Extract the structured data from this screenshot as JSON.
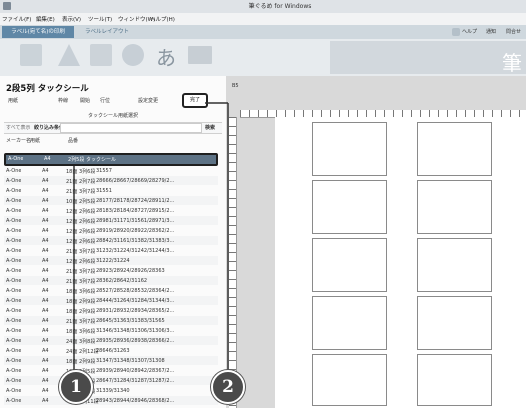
{
  "window": {
    "title": "筆ぐるめ for Windows"
  },
  "menu": [
    "ファイル(F)",
    "編集(E)",
    "表示(V)",
    "ツール(T)",
    "ウィンドウ(W)",
    "ヘルプ(H)"
  ],
  "ribbon": {
    "tabs": [
      "ラベル(宛て名)の印刷",
      "ラベルレイアウト"
    ],
    "right_links": [
      "ヘルプ",
      "通知",
      "問合せ"
    ],
    "right_big_label": "筆"
  },
  "panel": {
    "title": "2段5列 タックシール",
    "header_cols": [
      "用紙",
      "枠線",
      "開始",
      "行位",
      "設定変更"
    ],
    "complete_button": "完了",
    "sheet_select_label": "タックシール用紙選択",
    "filter_button": "すべて表示",
    "filter_label": "絞り込み条件",
    "search_button": "検索",
    "list_headers": [
      "メーカー名",
      "用紙",
      "品番"
    ],
    "selected_row": {
      "maker": "A-One",
      "size": "A4",
      "info": "2列5段 タックシール"
    },
    "rows": [
      {
        "maker": "A-One",
        "size": "A4",
        "desc": "18面 3列6段",
        "codes": "31557"
      },
      {
        "maker": "A-One",
        "size": "A4",
        "desc": "21面 2列7段",
        "codes": "28666/28667/28669/28279/2..."
      },
      {
        "maker": "A-One",
        "size": "A4",
        "desc": "21面 3列7段",
        "codes": "31551"
      },
      {
        "maker": "A-One",
        "size": "A4",
        "desc": "10面 2列5段",
        "codes": "28177/28178/28724/28911/2..."
      },
      {
        "maker": "A-One",
        "size": "A4",
        "desc": "12面 2列6段",
        "codes": "28183/28184/28727/28915/2..."
      },
      {
        "maker": "A-One",
        "size": "A4",
        "desc": "12面 2列6段",
        "codes": "28981/31171/31561/28971/3..."
      },
      {
        "maker": "A-One",
        "size": "A4",
        "desc": "12面 2列6段",
        "codes": "28919/28920/28922/28362/2..."
      },
      {
        "maker": "A-One",
        "size": "A4",
        "desc": "12面 2列6段",
        "codes": "28842/31161/31382/31383/3..."
      },
      {
        "maker": "A-One",
        "size": "A4",
        "desc": "21面 3列7段",
        "codes": "31232/31224/31242/31244/3..."
      },
      {
        "maker": "A-One",
        "size": "A4",
        "desc": "12面 2列6段",
        "codes": "31222/31224"
      },
      {
        "maker": "A-One",
        "size": "A4",
        "desc": "21面 3列7段",
        "codes": "28923/28924/28926/28363"
      },
      {
        "maker": "A-One",
        "size": "A4",
        "desc": "21面 3列7段",
        "codes": "28362/28642/31162"
      },
      {
        "maker": "A-One",
        "size": "A4",
        "desc": "18面 3列6段",
        "codes": "28527/28528/28532/28364/2..."
      },
      {
        "maker": "A-One",
        "size": "A4",
        "desc": "18面 2列9段",
        "codes": "28444/31264/31284/31344/3..."
      },
      {
        "maker": "A-One",
        "size": "A4",
        "desc": "18面 2列9段",
        "codes": "28931/28932/28934/28365/2..."
      },
      {
        "maker": "A-One",
        "size": "A4",
        "desc": "21面 3列7段",
        "codes": "28645/31363/31383/31565"
      },
      {
        "maker": "A-One",
        "size": "A4",
        "desc": "18面 3列6段",
        "codes": "31346/31348/31306/31306/3..."
      },
      {
        "maker": "A-One",
        "size": "A4",
        "desc": "24面 3列8段",
        "codes": "28935/28936/28938/28366/2..."
      },
      {
        "maker": "A-One",
        "size": "A4",
        "desc": "24面 2列12段",
        "codes": "28646/31263"
      },
      {
        "maker": "A-One",
        "size": "A4",
        "desc": "18面 2列9段",
        "codes": "31347/31348/31307/31308"
      },
      {
        "maker": "A-One",
        "size": "A4",
        "desc": "10面 2列5段",
        "codes": "28939/28940/28942/28367/2..."
      },
      {
        "maker": "A-One",
        "size": "A4",
        "desc": "12面 2列6段",
        "codes": "28647/31284/31287/31287/2..."
      },
      {
        "maker": "A-One",
        "size": "A4",
        "desc": "10面 2列5段",
        "codes": "31339/31340"
      },
      {
        "maker": "A-One",
        "size": "A4",
        "desc": "44面 4列11段",
        "codes": "28943/28944/28946/28368/2..."
      }
    ]
  },
  "canvas": {
    "page_label": "B5"
  },
  "callouts": [
    "1",
    "2"
  ]
}
